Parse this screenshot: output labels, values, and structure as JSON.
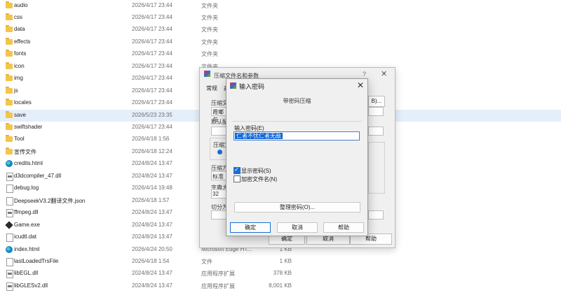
{
  "explorer": {
    "rows": [
      {
        "name": "audio",
        "date": "2026/4/17 23:44",
        "type": "文件夹",
        "size": "",
        "icon": "folder-icon"
      },
      {
        "name": "css",
        "date": "2026/4/17 23:44",
        "type": "文件夹",
        "size": "",
        "icon": "folder-icon"
      },
      {
        "name": "data",
        "date": "2026/4/17 23:44",
        "type": "文件夹",
        "size": "",
        "icon": "folder-icon"
      },
      {
        "name": "effects",
        "date": "2026/4/17 23:44",
        "type": "文件夹",
        "size": "",
        "icon": "folder-icon"
      },
      {
        "name": "fonts",
        "date": "2026/4/17 23:44",
        "type": "文件夹",
        "size": "",
        "icon": "folder-icon"
      },
      {
        "name": "icon",
        "date": "2026/4/17 23:44",
        "type": "文件夹",
        "size": "",
        "icon": "folder-icon"
      },
      {
        "name": "img",
        "date": "2026/4/17 23:44",
        "type": "",
        "size": "",
        "icon": "folder-icon"
      },
      {
        "name": "js",
        "date": "2026/4/17 23:44",
        "type": "",
        "size": "",
        "icon": "folder-icon"
      },
      {
        "name": "locales",
        "date": "2026/4/17 23:44",
        "type": "",
        "size": "",
        "icon": "folder-icon"
      },
      {
        "name": "save",
        "date": "2026/5/23 23:35",
        "type": "",
        "size": "",
        "icon": "folder-icon",
        "selected": true
      },
      {
        "name": "swiftshader",
        "date": "2026/4/17 23:44",
        "type": "",
        "size": "",
        "icon": "folder-icon"
      },
      {
        "name": "Tool",
        "date": "2026/4/18 1:56",
        "type": "",
        "size": "",
        "icon": "folder-icon"
      },
      {
        "name": "宣传文件",
        "date": "2026/4/18 12:24",
        "type": "",
        "size": "",
        "icon": "folder-icon"
      },
      {
        "name": "credits.html",
        "date": "2024/8/24 13:47",
        "type": "",
        "size": "",
        "icon": "edge-icon"
      },
      {
        "name": "d3dcompiler_47.dll",
        "date": "2024/8/24 13:47",
        "type": "",
        "size": "",
        "icon": "dll-icon"
      },
      {
        "name": "debug.log",
        "date": "2026/4/14 19:48",
        "type": "",
        "size": "",
        "icon": "file-icon"
      },
      {
        "name": "DeepseekV3.2翻译文件.json",
        "date": "2026/4/18 1:57",
        "type": "",
        "size": "",
        "icon": "file-icon"
      },
      {
        "name": "ffmpeg.dll",
        "date": "2024/8/24 13:47",
        "type": "",
        "size": "",
        "icon": "dll-icon"
      },
      {
        "name": "Game.exe",
        "date": "2024/8/24 13:47",
        "type": "",
        "size": "",
        "icon": "exe-icon"
      },
      {
        "name": "icudtl.dat",
        "date": "2024/8/24 13:47",
        "type": "",
        "size": "",
        "icon": "file-icon"
      },
      {
        "name": "index.html",
        "date": "2026/4/24 20:50",
        "type": "Microsoft Edge HT...",
        "size": "1 KB",
        "icon": "edge-icon"
      },
      {
        "name": "lastLoadedTrsFile",
        "date": "2026/4/18 1:54",
        "type": "文件",
        "size": "1 KB",
        "icon": "file-icon"
      },
      {
        "name": "libEGL.dll",
        "date": "2024/8/24 13:47",
        "type": "应用程序扩展",
        "size": "378 KB",
        "icon": "dll-icon"
      },
      {
        "name": "libGLESv2.dll",
        "date": "2024/8/24 13:47",
        "type": "应用程序扩展",
        "size": "8,001 KB",
        "icon": "dll-icon"
      }
    ]
  },
  "bg_dialog": {
    "title": "压缩文件名和参数",
    "help": "?",
    "close": "✕",
    "tab_general": "常规",
    "tab_2": "高",
    "label_archive": "压缩文",
    "field_archive": "霞鄉与",
    "label_default": "默认配",
    "label_format": "压缩文",
    "label_method": "压缩方",
    "field_method": "标准",
    "label_dict": "字典大",
    "field_dict": "32",
    "label_split": "切分为",
    "browse_btn": "B)...",
    "ok": "确定",
    "cancel": "取消",
    "help_btn": "帮助"
  },
  "pwd_dialog": {
    "title": "输入密码",
    "close": "✕",
    "subtitle": "带密码压缩",
    "pwd_label": "输入密码(E)",
    "pwd_value": "仁者不忧仁者无敌",
    "show_pwd": "显示密码(S)",
    "show_pwd_checked": true,
    "encrypt_names": "加密文件名(N)",
    "encrypt_names_checked": false,
    "organize_btn": "整理密码(O)...",
    "ok": "确定",
    "cancel": "取消",
    "help": "帮助"
  }
}
